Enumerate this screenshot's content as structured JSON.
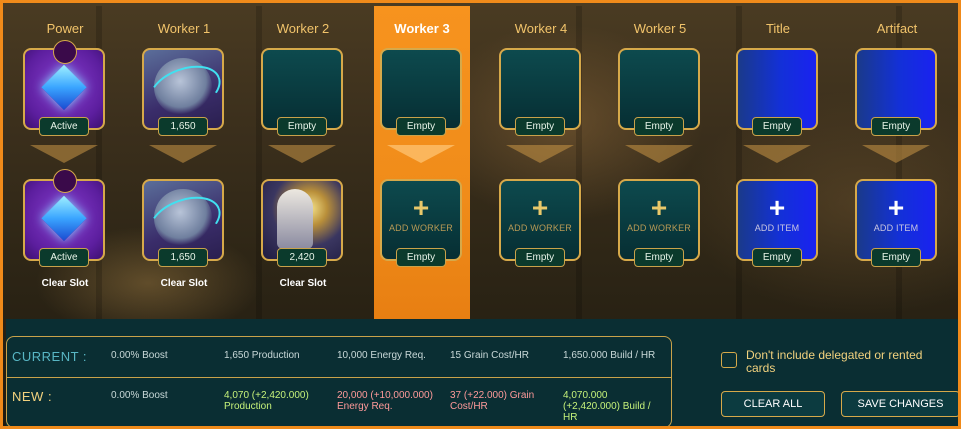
{
  "columns": [
    {
      "header": "Power"
    },
    {
      "header": "Worker 1"
    },
    {
      "header": "Worker 2"
    },
    {
      "header": "Worker 3"
    },
    {
      "header": "Worker 4"
    },
    {
      "header": "Worker 5"
    },
    {
      "header": "Title"
    },
    {
      "header": "Artifact"
    }
  ],
  "selected_column": "Worker 3",
  "top_row": {
    "power": "Active",
    "worker1": "1,650",
    "worker2": "Empty",
    "worker3": "Empty",
    "worker4": "Empty",
    "worker5": "Empty",
    "title": "Empty",
    "artifact": "Empty"
  },
  "bottom_row": {
    "power": {
      "status": "Active",
      "action": "Clear Slot"
    },
    "worker1": {
      "value": "1,650",
      "action": "Clear Slot"
    },
    "worker2": {
      "value": "2,420",
      "action": "Clear Slot"
    },
    "worker3": {
      "plus": "+",
      "add_label": "ADD WORKER",
      "status": "Empty"
    },
    "worker4": {
      "plus": "+",
      "add_label": "ADD WORKER",
      "status": "Empty"
    },
    "worker5": {
      "plus": "+",
      "add_label": "ADD WORKER",
      "status": "Empty"
    },
    "title": {
      "plus": "+",
      "add_label": "ADD ITEM",
      "status": "Empty"
    },
    "artifact": {
      "plus": "+",
      "add_label": "ADD ITEM",
      "status": "Empty"
    }
  },
  "stats": {
    "current": {
      "label": "CURRENT :",
      "boost": "0.00% Boost",
      "production": "1,650 Production",
      "energy": "10,000 Energy Req.",
      "grain": "15 Grain Cost/HR",
      "build": "1,650.000 Build / HR"
    },
    "new": {
      "label": "NEW :",
      "boost": "0.00% Boost",
      "production": "4,070 (+2,420.000) Production",
      "energy": "20,000 (+10,000.000) Energy Req.",
      "grain": "37 (+22.000) Grain Cost/HR",
      "build": "4,070.000 (+2,420.000) Build / HR"
    }
  },
  "delegated_checkbox": {
    "label": "Don't include delegated or rented cards",
    "checked": false
  },
  "buttons": {
    "clear_all": "CLEAR ALL",
    "save_changes": "SAVE CHANGES"
  },
  "colors": {
    "accent_orange": "#f08a1a",
    "gold": "#d6a94a",
    "panel": "#0a2e33",
    "title_blue": "#1330d8"
  }
}
